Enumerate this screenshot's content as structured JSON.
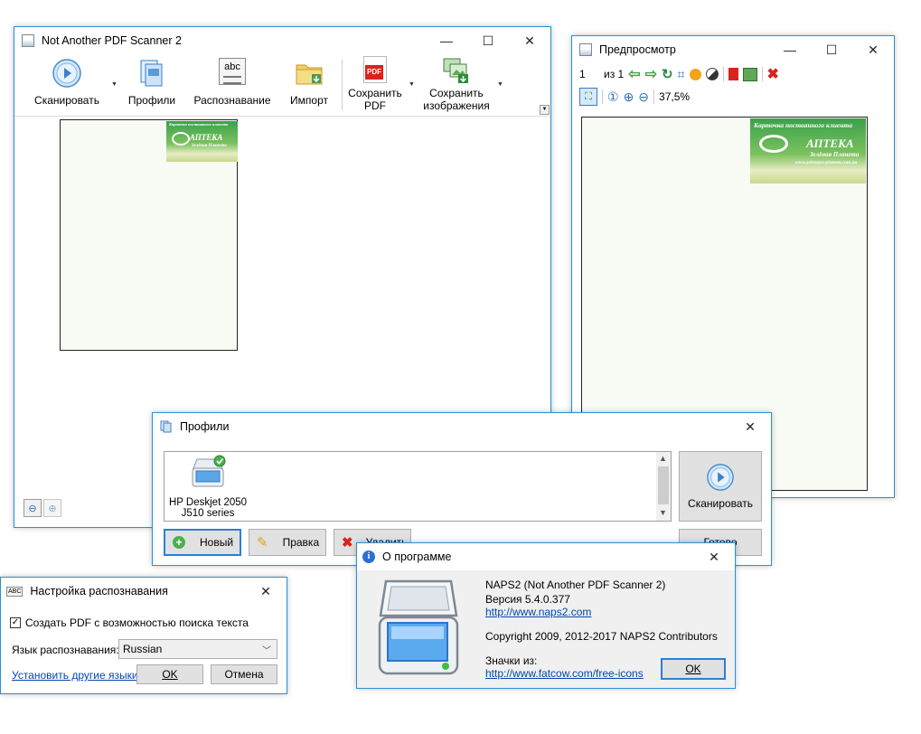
{
  "main": {
    "title": "Not Another PDF Scanner 2",
    "toolbar": {
      "scan": "Сканировать",
      "profiles": "Профили",
      "ocr": "Распознавание",
      "import": "Импорт",
      "save_pdf_1": "Сохранить",
      "save_pdf_2": "PDF",
      "save_img_1": "Сохранить",
      "save_img_2": "изображения",
      "pdf_icon_text": "PDF",
      "abc_icon_text": "abc"
    },
    "thumb_card": {
      "line1": "Карточка постоянного клиента",
      "line2": "АПТЕКА",
      "line3": "Зелёная Планета"
    }
  },
  "preview": {
    "title": "Предпросмотр",
    "page_num": "1",
    "page_of": "из 1",
    "zoom": "37,5%",
    "card": {
      "line1": "Карточка постоянного клиента",
      "line2": "АПТЕКА",
      "line3": "Зелёная Планета",
      "line4": "www.zelenaya-planeta.com.ua"
    }
  },
  "profiles": {
    "title": "Профили",
    "device_1": "HP Deskjet 2050",
    "device_2": "J510 series",
    "scan": "Сканировать",
    "new": "Новый",
    "edit": "Правка",
    "delete": "Удалить",
    "done": "Готово"
  },
  "about": {
    "title": "О программе",
    "name": "NAPS2 (Not Another PDF Scanner 2)",
    "version": "Версия 5.4.0.377",
    "url": "http://www.naps2.com",
    "copyright": "Copyright 2009, 2012-2017 NAPS2 Contributors",
    "icons_label": "Значки из:",
    "icons_url": "http://www.fatcow.com/free-icons",
    "ok": "OK"
  },
  "ocr": {
    "title": "Настройка распознавания",
    "checkbox_label": "Создать PDF с возможностью поиска текста",
    "lang_label": "Язык распознавания:",
    "lang_value": "Russian",
    "other_langs": "Установить другие языки",
    "ok": "OK",
    "cancel": "Отмена",
    "icon_text": "ABC"
  },
  "colors": {
    "accent": "#2b8fd6",
    "link": "#0645ad",
    "card_green": "#3aa14c"
  }
}
